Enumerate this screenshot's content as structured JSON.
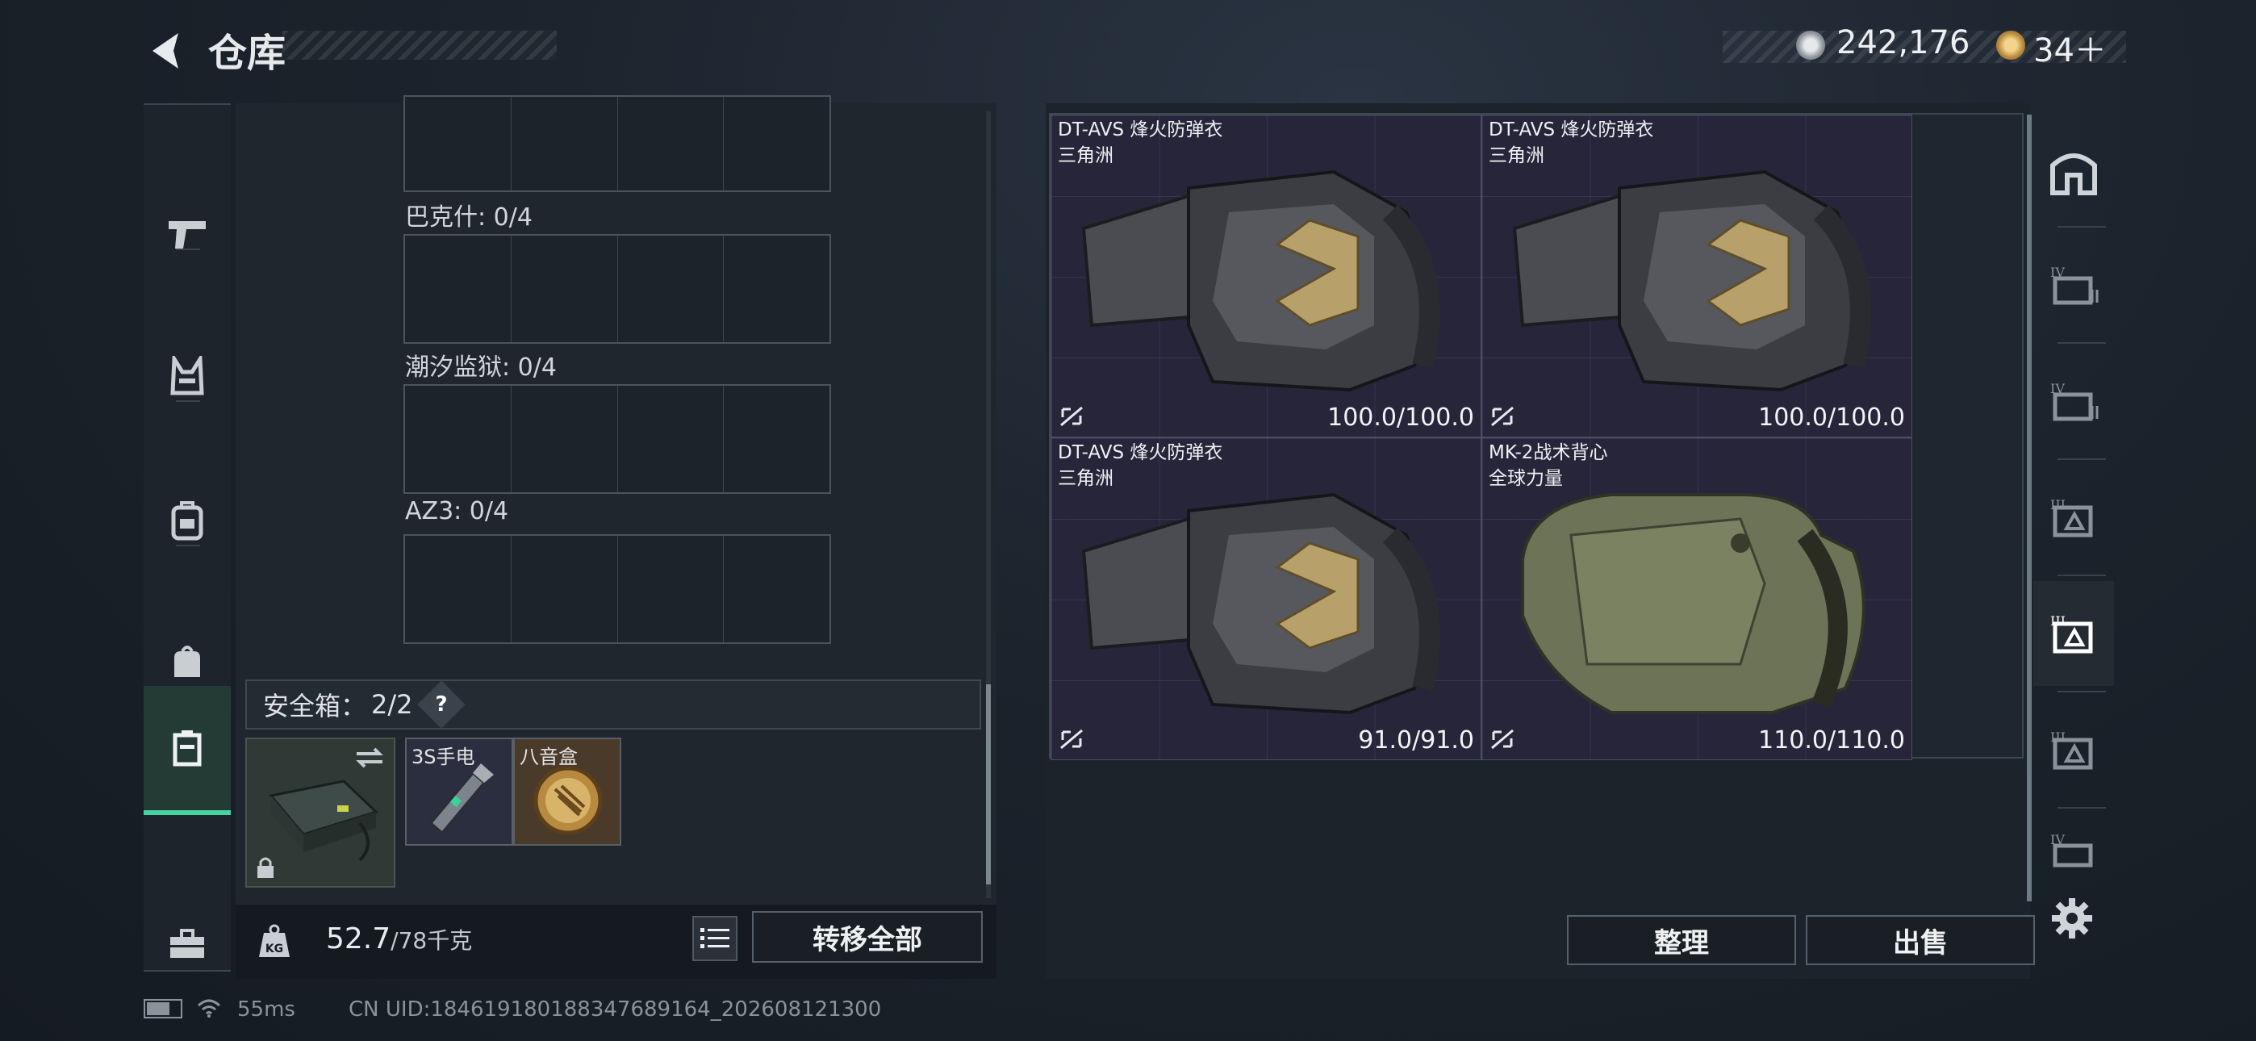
{
  "header": {
    "title": "仓库",
    "currency_primary": "242,176",
    "currency_secondary": "34＋",
    "coin_colors": {
      "primary": "#b9c0c7",
      "secondary": "#c9a25b"
    }
  },
  "left_rail": {
    "items": [
      {
        "name": "weapons",
        "icon": "pistol-icon"
      },
      {
        "name": "armor-rig",
        "icon": "chest-rig-icon"
      },
      {
        "name": "backpack",
        "icon": "backpack-icon"
      },
      {
        "name": "bag",
        "icon": "pouch-icon"
      },
      {
        "name": "safe-case",
        "icon": "case-icon",
        "active": true
      },
      {
        "name": "toolbox",
        "icon": "toolbox-icon"
      }
    ],
    "accent": "#48d3a0"
  },
  "left_panel": {
    "key_slots": [
      {
        "label": "巴克什: 0/4"
      },
      {
        "label": "潮汐监狱: 0/4"
      },
      {
        "label": "AZ3: 0/4"
      }
    ],
    "safe_box_label": "安全箱：",
    "safe_box_count": "2/2",
    "help": "?",
    "safe_items": [
      {
        "label": "3S手电"
      },
      {
        "label": "八音盒"
      }
    ],
    "weight_value": "52.7",
    "weight_max": "/78千克",
    "transfer_all": "转移全部"
  },
  "right_panel": {
    "items": [
      {
        "name": "DT-AVS 烽火防弹衣",
        "map": "三角洲",
        "durability": "100.0/100.0"
      },
      {
        "name": "DT-AVS 烽火防弹衣",
        "map": "三角洲",
        "durability": "100.0/100.0"
      },
      {
        "name": "DT-AVS 烽火防弹衣",
        "map": "三角洲",
        "durability": "91.0/91.0"
      },
      {
        "name": "MK-2战术背心",
        "map": "全球力量",
        "durability": "110.0/110.0"
      }
    ],
    "sort_button": "整理",
    "sell_button": "出售"
  },
  "status_bar": {
    "ping": "55ms",
    "uid": "CN UID:18461918018834768​9164_202608121300"
  }
}
